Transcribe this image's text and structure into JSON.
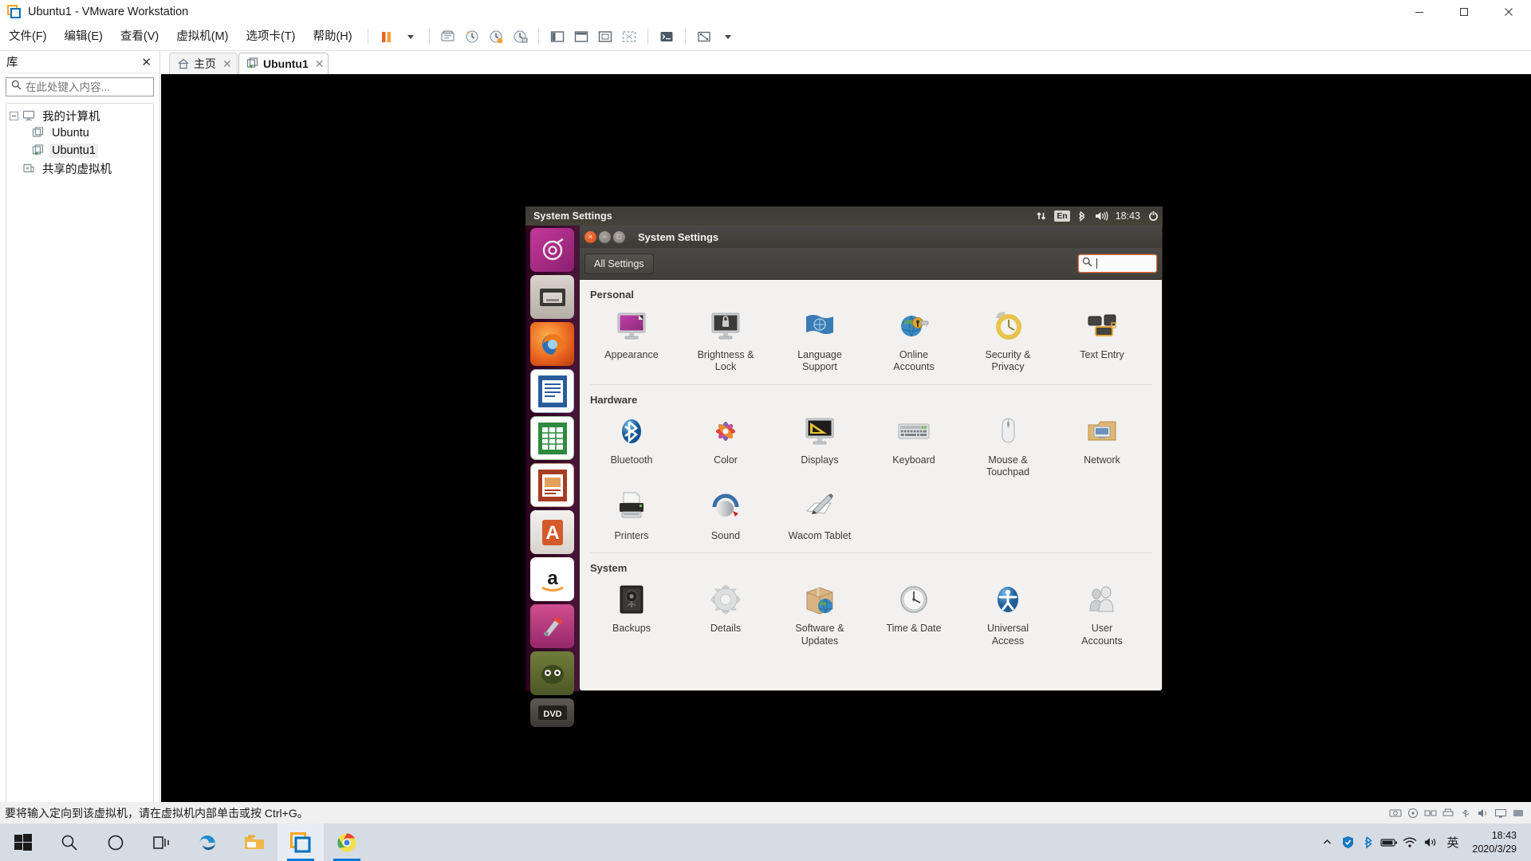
{
  "vmware": {
    "window_title": "Ubuntu1 - VMware Workstation",
    "menus": [
      {
        "label": "文件(F)"
      },
      {
        "label": "编辑(E)"
      },
      {
        "label": "查看(V)"
      },
      {
        "label": "虚拟机(M)"
      },
      {
        "label": "选项卡(T)"
      },
      {
        "label": "帮助(H)"
      }
    ],
    "toolbar_icons": [
      "pause-icon",
      "dropdown-caret-icon",
      "snapshot-manager-icon",
      "revert-snapshot-icon",
      "take-snapshot-icon",
      "snapshot-list-icon",
      "show-sidebar-icon",
      "show-console-icon",
      "fit-guest-icon",
      "fit-window-icon",
      "unity-mode-icon",
      "fullscreen-icon",
      "layout-caret-icon"
    ],
    "window_buttons": {
      "minimize": "minimize-button",
      "maximize": "maximize-button",
      "close": "close-button"
    },
    "library": {
      "title": "库",
      "close_label": "✕",
      "search_placeholder": "在此处键入内容...",
      "search_value": "",
      "tree": [
        {
          "label": "我的计算机",
          "icon": "computer-icon",
          "level": 0,
          "expanded": true,
          "selected": false
        },
        {
          "label": "Ubuntu",
          "icon": "vm-icon",
          "level": 1,
          "expanded": false,
          "selected": false
        },
        {
          "label": "Ubuntu1",
          "icon": "vm-running-icon",
          "level": 1,
          "expanded": false,
          "selected": true
        },
        {
          "label": "共享的虚拟机",
          "icon": "shared-vms-icon",
          "level": 0,
          "expanded": false,
          "selected": false
        }
      ]
    },
    "tabs": [
      {
        "label": "主页",
        "icon": "home-icon",
        "active": false,
        "closable": true
      },
      {
        "label": "Ubuntu1",
        "icon": "vm-running-icon",
        "active": true,
        "closable": true
      }
    ],
    "statusbar": {
      "message": "要将输入定向到该虚拟机，请在虚拟机内部单击或按 Ctrl+G。",
      "device_icons": [
        "hard-disk-icon",
        "cd-dvd-icon",
        "network-adapter-icon",
        "printer-icon",
        "usb-icon",
        "sound-card-icon",
        "display-icon",
        "more-devices-icon"
      ]
    }
  },
  "ubuntu": {
    "top_panel": {
      "app_menu_title": "System Settings",
      "indicators": [
        {
          "name": "network-indicator",
          "glyph": "⇅"
        },
        {
          "name": "keyboard-layout-indicator",
          "glyph": "En"
        },
        {
          "name": "bluetooth-indicator",
          "glyph": "✶"
        },
        {
          "name": "volume-indicator",
          "glyph": "◂)))"
        }
      ],
      "clock": "18:43",
      "session_indicator": "power-gear-icon"
    },
    "launcher": [
      {
        "name": "dash-home-icon"
      },
      {
        "name": "files-nautilus-icon"
      },
      {
        "name": "firefox-icon"
      },
      {
        "name": "libreoffice-writer-icon"
      },
      {
        "name": "libreoffice-calc-icon"
      },
      {
        "name": "libreoffice-impress-icon"
      },
      {
        "name": "ubuntu-software-center-icon"
      },
      {
        "name": "amazon-icon"
      },
      {
        "name": "system-settings-icon"
      },
      {
        "name": "help-icon"
      },
      {
        "name": "dvd-media-icon"
      }
    ],
    "window": {
      "title": "System Settings",
      "buttons": {
        "close": "×",
        "minimize": "−",
        "maximize": "□"
      },
      "toolbar": {
        "all_settings_label": "All Settings",
        "search_placeholder": "",
        "search_value": "",
        "search_icon": "search-icon"
      },
      "sections": [
        {
          "title": "Personal",
          "items": [
            {
              "label": "Appearance",
              "icon": "appearance-icon"
            },
            {
              "label": "Brightness &\nLock",
              "icon": "brightness-lock-icon"
            },
            {
              "label": "Language\nSupport",
              "icon": "language-support-icon"
            },
            {
              "label": "Online\nAccounts",
              "icon": "online-accounts-icon"
            },
            {
              "label": "Security &\nPrivacy",
              "icon": "security-privacy-icon"
            },
            {
              "label": "Text Entry",
              "icon": "text-entry-icon"
            }
          ]
        },
        {
          "title": "Hardware",
          "items": [
            {
              "label": "Bluetooth",
              "icon": "bluetooth-icon"
            },
            {
              "label": "Color",
              "icon": "color-icon"
            },
            {
              "label": "Displays",
              "icon": "displays-icon"
            },
            {
              "label": "Keyboard",
              "icon": "keyboard-icon"
            },
            {
              "label": "Mouse &\nTouchpad",
              "icon": "mouse-touchpad-icon"
            },
            {
              "label": "Network",
              "icon": "network-icon"
            },
            {
              "label": "Printers",
              "icon": "printers-icon"
            },
            {
              "label": "Sound",
              "icon": "sound-icon"
            },
            {
              "label": "Wacom Tablet",
              "icon": "wacom-tablet-icon"
            }
          ]
        },
        {
          "title": "System",
          "items": [
            {
              "label": "Backups",
              "icon": "backups-icon"
            },
            {
              "label": "Details",
              "icon": "details-icon"
            },
            {
              "label": "Software &\nUpdates",
              "icon": "software-updates-icon"
            },
            {
              "label": "Time & Date",
              "icon": "time-date-icon"
            },
            {
              "label": "Universal\nAccess",
              "icon": "universal-access-icon"
            },
            {
              "label": "User\nAccounts",
              "icon": "user-accounts-icon"
            }
          ]
        }
      ]
    }
  },
  "windows_taskbar": {
    "start_button": "start-button",
    "items": [
      {
        "name": "taskbar-search-icon",
        "running": false,
        "active": false
      },
      {
        "name": "taskbar-cortana-icon",
        "running": false,
        "active": false
      },
      {
        "name": "taskbar-task-view-icon",
        "running": false,
        "active": false
      },
      {
        "name": "taskbar-edge-icon",
        "running": false,
        "active": false
      },
      {
        "name": "taskbar-file-explorer-icon",
        "running": false,
        "active": false
      },
      {
        "name": "taskbar-vmware-icon",
        "running": true,
        "active": true
      },
      {
        "name": "taskbar-chrome-icon",
        "running": true,
        "active": false
      }
    ],
    "tray": {
      "overflow_icon": "show-hidden-icons-icon",
      "icons": [
        {
          "name": "security-shield-icon"
        },
        {
          "name": "bluetooth-tray-icon"
        },
        {
          "name": "battery-tray-icon"
        },
        {
          "name": "network-tray-icon"
        },
        {
          "name": "volume-tray-icon"
        }
      ],
      "ime_label": "英",
      "clock_time": "18:43",
      "clock_date": "2020/3/29"
    }
  },
  "colors": {
    "vmware_orange": "#f5a623",
    "vmware_blue": "#0070c0",
    "ubuntu_aubergine": "#2c001e",
    "ubuntu_orange": "#e8703a",
    "windows_accent": "#0078d7",
    "taskbar_bg": "#d6dce4",
    "settings_bg": "#f2f1f0"
  }
}
